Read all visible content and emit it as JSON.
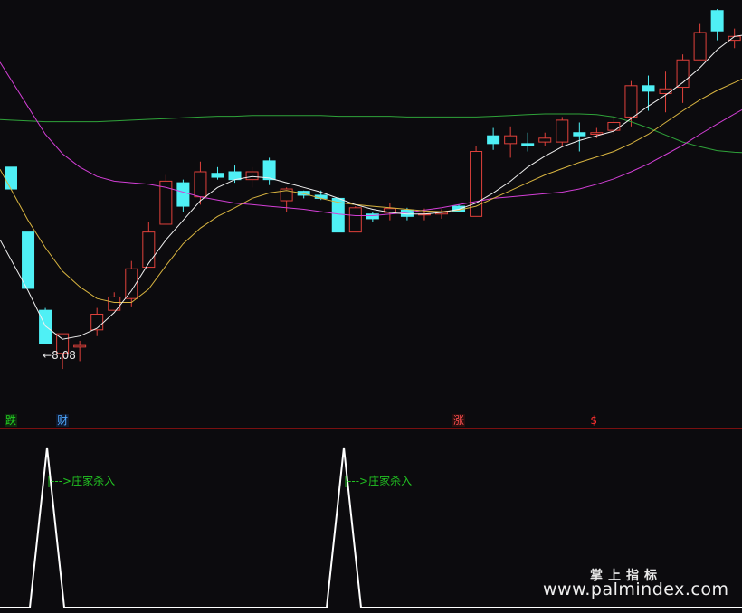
{
  "chart_data": [
    {
      "type": "candlestick",
      "price_range": [
        7.6,
        12.8
      ],
      "colors": {
        "up": "#e0413b",
        "down": "#4ff0f5",
        "ma_fast": "#f0f0f0",
        "ma_mid": "#d8b440",
        "ma_slow": "#d33fd6",
        "ma_long": "#2fa33a"
      },
      "candles": [
        {
          "x": 0,
          "o": 10.78,
          "h": 10.78,
          "l": 10.5,
          "c": 10.5
        },
        {
          "x": 1,
          "o": 9.95,
          "h": 9.95,
          "l": 9.23,
          "c": 9.23
        },
        {
          "x": 2,
          "o": 8.95,
          "h": 8.98,
          "l": 8.52,
          "c": 8.52
        },
        {
          "x": 3,
          "o": 8.4,
          "h": 8.65,
          "l": 8.2,
          "c": 8.65
        },
        {
          "x": 4,
          "o": 8.48,
          "h": 8.56,
          "l": 8.3,
          "c": 8.5
        },
        {
          "x": 5,
          "o": 8.7,
          "h": 8.98,
          "l": 8.62,
          "c": 8.9
        },
        {
          "x": 6,
          "o": 8.95,
          "h": 9.18,
          "l": 8.95,
          "c": 9.12
        },
        {
          "x": 7,
          "o": 9.1,
          "h": 9.58,
          "l": 9.0,
          "c": 9.48
        },
        {
          "x": 8,
          "o": 9.5,
          "h": 10.08,
          "l": 9.5,
          "c": 9.95
        },
        {
          "x": 9,
          "o": 10.05,
          "h": 10.68,
          "l": 10.05,
          "c": 10.6
        },
        {
          "x": 10,
          "o": 10.58,
          "h": 10.62,
          "l": 10.2,
          "c": 10.28
        },
        {
          "x": 11,
          "o": 10.4,
          "h": 10.85,
          "l": 10.3,
          "c": 10.72
        },
        {
          "x": 12,
          "o": 10.7,
          "h": 10.78,
          "l": 10.62,
          "c": 10.65
        },
        {
          "x": 13,
          "o": 10.72,
          "h": 10.8,
          "l": 10.58,
          "c": 10.62
        },
        {
          "x": 14,
          "o": 10.62,
          "h": 10.78,
          "l": 10.52,
          "c": 10.72
        },
        {
          "x": 15,
          "o": 10.86,
          "h": 10.9,
          "l": 10.55,
          "c": 10.62
        },
        {
          "x": 16,
          "o": 10.35,
          "h": 10.52,
          "l": 10.2,
          "c": 10.5
        },
        {
          "x": 17,
          "o": 10.47,
          "h": 10.48,
          "l": 10.38,
          "c": 10.42
        },
        {
          "x": 18,
          "o": 10.42,
          "h": 10.48,
          "l": 10.36,
          "c": 10.38
        },
        {
          "x": 19,
          "o": 10.38,
          "h": 10.4,
          "l": 9.95,
          "c": 9.95
        },
        {
          "x": 20,
          "o": 9.95,
          "h": 10.28,
          "l": 9.95,
          "c": 10.26
        },
        {
          "x": 21,
          "o": 10.18,
          "h": 10.21,
          "l": 10.08,
          "c": 10.12
        },
        {
          "x": 22,
          "o": 10.2,
          "h": 10.32,
          "l": 10.1,
          "c": 10.25
        },
        {
          "x": 23,
          "o": 10.23,
          "h": 10.26,
          "l": 10.1,
          "c": 10.15
        },
        {
          "x": 24,
          "o": 10.18,
          "h": 10.25,
          "l": 10.1,
          "c": 10.18
        },
        {
          "x": 25,
          "o": 10.18,
          "h": 10.24,
          "l": 10.12,
          "c": 10.2
        },
        {
          "x": 26,
          "o": 10.28,
          "h": 10.3,
          "l": 10.2,
          "c": 10.21
        },
        {
          "x": 27,
          "o": 10.15,
          "h": 11.05,
          "l": 10.15,
          "c": 10.98
        },
        {
          "x": 28,
          "o": 11.18,
          "h": 11.28,
          "l": 11.0,
          "c": 11.08
        },
        {
          "x": 29,
          "o": 11.08,
          "h": 11.3,
          "l": 10.9,
          "c": 11.18
        },
        {
          "x": 30,
          "o": 11.08,
          "h": 11.22,
          "l": 10.98,
          "c": 11.05
        },
        {
          "x": 31,
          "o": 11.1,
          "h": 11.22,
          "l": 11.05,
          "c": 11.15
        },
        {
          "x": 32,
          "o": 11.1,
          "h": 11.42,
          "l": 11.05,
          "c": 11.38
        },
        {
          "x": 33,
          "o": 11.22,
          "h": 11.35,
          "l": 10.98,
          "c": 11.18
        },
        {
          "x": 34,
          "o": 11.2,
          "h": 11.28,
          "l": 11.15,
          "c": 11.22
        },
        {
          "x": 35,
          "o": 11.25,
          "h": 11.42,
          "l": 11.2,
          "c": 11.35
        },
        {
          "x": 36,
          "o": 11.42,
          "h": 11.88,
          "l": 11.3,
          "c": 11.82
        },
        {
          "x": 37,
          "o": 11.82,
          "h": 11.95,
          "l": 11.5,
          "c": 11.75
        },
        {
          "x": 38,
          "o": 11.72,
          "h": 12.0,
          "l": 11.48,
          "c": 11.78
        },
        {
          "x": 39,
          "o": 11.8,
          "h": 12.22,
          "l": 11.6,
          "c": 12.15
        },
        {
          "x": 40,
          "o": 12.15,
          "h": 12.62,
          "l": 12.15,
          "c": 12.5
        },
        {
          "x": 41,
          "o": 12.78,
          "h": 12.8,
          "l": 12.4,
          "c": 12.52
        },
        {
          "x": 42,
          "o": 12.4,
          "h": 12.55,
          "l": 12.3,
          "c": 12.45
        },
        {
          "x": 43,
          "o": 12.48,
          "h": 12.5,
          "l": 12.2,
          "c": 12.25
        }
      ],
      "ma_fast": [
        9.6,
        9.2,
        8.75,
        8.58,
        8.62,
        8.72,
        8.92,
        9.2,
        9.55,
        9.85,
        10.1,
        10.35,
        10.52,
        10.62,
        10.66,
        10.64,
        10.58,
        10.52,
        10.46,
        10.38,
        10.3,
        10.24,
        10.2,
        10.18,
        10.18,
        10.2,
        10.24,
        10.32,
        10.45,
        10.6,
        10.78,
        10.92,
        11.04,
        11.12,
        11.18,
        11.24,
        11.4,
        11.56,
        11.7,
        11.86,
        12.05,
        12.28,
        12.45,
        12.48
      ],
      "ma_mid": [
        10.5,
        10.1,
        9.75,
        9.45,
        9.25,
        9.1,
        9.05,
        9.05,
        9.22,
        9.52,
        9.8,
        10.0,
        10.15,
        10.26,
        10.38,
        10.45,
        10.48,
        10.44,
        10.38,
        10.33,
        10.3,
        10.28,
        10.26,
        10.24,
        10.22,
        10.21,
        10.23,
        10.28,
        10.38,
        10.48,
        10.58,
        10.68,
        10.76,
        10.84,
        10.91,
        10.98,
        11.08,
        11.2,
        11.35,
        11.5,
        11.64,
        11.76,
        11.86,
        11.96
      ],
      "ma_slow": [
        11.9,
        11.55,
        11.2,
        10.95,
        10.78,
        10.66,
        10.6,
        10.58,
        10.56,
        10.52,
        10.46,
        10.4,
        10.36,
        10.32,
        10.3,
        10.28,
        10.26,
        10.24,
        10.21,
        10.18,
        10.16,
        10.16,
        10.18,
        10.2,
        10.23,
        10.26,
        10.3,
        10.34,
        10.38,
        10.4,
        10.42,
        10.44,
        10.46,
        10.5,
        10.56,
        10.63,
        10.72,
        10.82,
        10.94,
        11.06,
        11.2,
        11.33,
        11.46,
        11.58
      ],
      "ma_long": [
        11.38,
        11.37,
        11.36,
        11.36,
        11.36,
        11.36,
        11.37,
        11.38,
        11.39,
        11.4,
        11.41,
        11.42,
        11.43,
        11.43,
        11.44,
        11.44,
        11.44,
        11.44,
        11.44,
        11.43,
        11.43,
        11.43,
        11.43,
        11.42,
        11.42,
        11.42,
        11.42,
        11.42,
        11.43,
        11.44,
        11.45,
        11.46,
        11.46,
        11.46,
        11.45,
        11.42,
        11.36,
        11.28,
        11.19,
        11.1,
        11.04,
        10.99,
        10.97,
        10.96
      ],
      "low_marker": {
        "label": "←8.08",
        "x": 2
      }
    },
    {
      "type": "line",
      "x": [
        0,
        1,
        2,
        3,
        4,
        5,
        6,
        7,
        8,
        9
      ],
      "values": [
        0,
        1,
        0,
        0,
        0,
        0,
        0,
        0,
        1,
        0
      ],
      "ylim": [
        0,
        1
      ],
      "color": "#ffffff"
    }
  ],
  "signals": [
    {
      "label": "跌",
      "color": "#22cc22",
      "bg": "#0e2a0e"
    },
    {
      "label": "财",
      "color": "#4fa8ff",
      "bg": "#0e1a30"
    },
    {
      "label": "涨",
      "color": "#ff5050",
      "bg": "#2a0e0e"
    },
    {
      "label": "$",
      "color": "#ff3030",
      "bg": "transparent"
    }
  ],
  "annotations": [
    {
      "label": "|--->庄家杀入"
    },
    {
      "label": "|--->庄家杀入"
    }
  ],
  "watermark": {
    "cn": "掌上指标",
    "url": "www.palmindex.com"
  }
}
